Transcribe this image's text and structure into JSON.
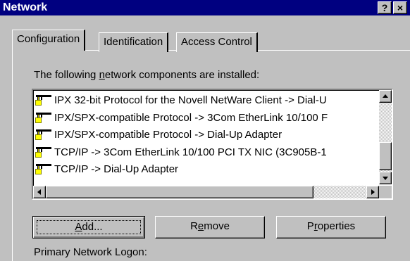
{
  "window": {
    "title": "Network",
    "help_label": "?",
    "close_label": "×"
  },
  "tabs": [
    {
      "label": "Configuration",
      "selected": true
    },
    {
      "label": "Identification",
      "selected": false
    },
    {
      "label": "Access Control",
      "selected": false
    }
  ],
  "components": {
    "label_pre": "The following ",
    "label_mnemonic": "n",
    "label_post": "etwork components are installed:",
    "items": [
      {
        "icon": "network-protocol-icon",
        "text": "IPX 32-bit Protocol for the Novell NetWare Client -> Dial-U"
      },
      {
        "icon": "network-protocol-icon",
        "text": "IPX/SPX-compatible Protocol -> 3Com EtherLink 10/100 F"
      },
      {
        "icon": "network-protocol-icon",
        "text": "IPX/SPX-compatible Protocol -> Dial-Up Adapter"
      },
      {
        "icon": "network-protocol-icon",
        "text": "TCP/IP -> 3Com EtherLink 10/100 PCI TX NIC (3C905B-1"
      },
      {
        "icon": "network-protocol-icon",
        "text": "TCP/IP -> Dial-Up Adapter"
      }
    ]
  },
  "buttons": {
    "add_mnemonic": "A",
    "add_rest": "dd...",
    "remove_pre": "R",
    "remove_mnemonic": "e",
    "remove_post": "move",
    "properties_pre": "P",
    "properties_mnemonic": "r",
    "properties_post": "operties"
  },
  "bottom_label": "Primary Network Logon:"
}
